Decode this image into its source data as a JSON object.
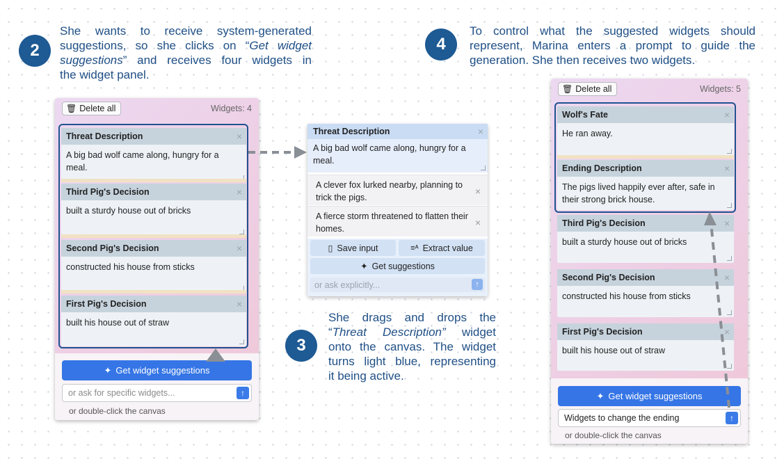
{
  "steps": {
    "s2": {
      "number": "2",
      "line1": "She wants to receive system-generated",
      "line2a": "suggestions, so she clicks on “",
      "line2b": "Get widget",
      "line3a": "suggestions",
      "line3b": "” and receives four widgets in",
      "line4": "the widget panel."
    },
    "s3": {
      "number": "3",
      "line1": "She drags and drops the",
      "line2a": "“",
      "line2b": "Threat Description”",
      "line2c": " widget",
      "line3": "onto the canvas. The widget",
      "line4": "turns light blue, representing",
      "line5": "it being active."
    },
    "s4": {
      "number": "4",
      "line1": "To control what the suggested widgets should",
      "line2": "represent, Marina  enters a prompt to guide the",
      "line3": "generation. She then receives two widgets."
    }
  },
  "left_panel": {
    "delete_all": "Delete all",
    "widgets_count": "Widgets: 4",
    "widgets": [
      {
        "title": "Threat Description",
        "body": "A big bad wolf came along, hungry for a meal."
      },
      {
        "title": "Third Pig's Decision",
        "body": "built a sturdy house out of bricks"
      },
      {
        "title": "Second Pig's Decision",
        "body": "constructed his house from sticks"
      },
      {
        "title": "First Pig's Decision",
        "body": "built his house out of straw"
      }
    ],
    "get_suggestions": "Get widget suggestions",
    "ask_placeholder": "or ask for specific widgets...",
    "hint": "or double-click the canvas"
  },
  "active_widget": {
    "title": "Threat Description",
    "body": "A big bad wolf came along, hungry for a meal.",
    "suggestions": [
      "A clever fox lurked nearby, planning to trick the pigs.",
      "A fierce storm threatened to flatten their homes."
    ],
    "save_input": "Save input",
    "extract_value": "Extract value",
    "get_suggestions": "Get suggestions",
    "ask_placeholder": "or ask explicitly..."
  },
  "right_panel": {
    "delete_all": "Delete all",
    "widgets_count": "Widgets: 5",
    "widgets": [
      {
        "title": "Wolf's Fate",
        "body": "He ran away."
      },
      {
        "title": "Ending Description",
        "body": "The pigs lived happily ever after, safe in their strong brick house."
      },
      {
        "title": "Third Pig's Decision",
        "body": "built a sturdy house out of bricks"
      },
      {
        "title": "Second Pig's Decision",
        "body": "constructed his house from sticks"
      },
      {
        "title": "First Pig's Decision",
        "body": "built his house out of straw"
      }
    ],
    "get_suggestions": "Get widget suggestions",
    "ask_value": "Widgets to change the ending",
    "hint": "or double-click the canvas"
  },
  "colors": {
    "step_blue": "#1f4f86",
    "badge_blue": "#1e5a93",
    "button_blue": "#3575e6",
    "active_frame": "#1f5290",
    "arrow_gray": "#8a8f96"
  }
}
